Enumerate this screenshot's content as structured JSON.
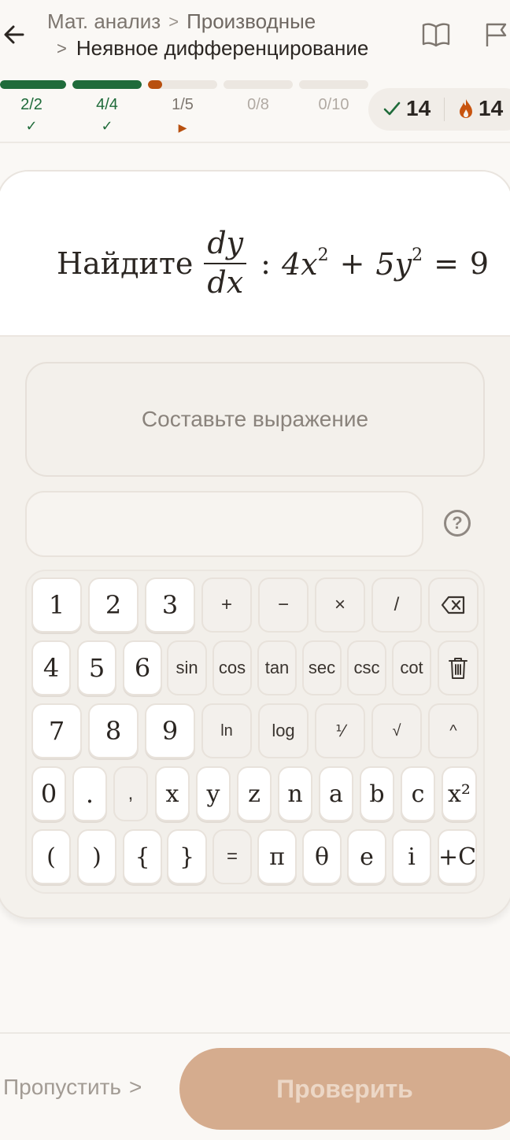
{
  "header": {
    "breadcrumb_root": "Мат. анализ",
    "breadcrumb_section": "Производные",
    "breadcrumb_current": "Неявное дифференцирование",
    "separator": ">"
  },
  "progress": {
    "segments": [
      {
        "label": "2/2",
        "fraction": 1.0,
        "state": "done",
        "mark": "✓",
        "color": "#1f6b3a"
      },
      {
        "label": "4/4",
        "fraction": 1.0,
        "state": "done",
        "mark": "✓",
        "color": "#1f6b3a"
      },
      {
        "label": "1/5",
        "fraction": 0.2,
        "state": "active",
        "mark": "▶",
        "color": "#b8500f"
      },
      {
        "label": "0/8",
        "fraction": 0.0,
        "state": "todo",
        "mark": "",
        "color": "#ece7e1"
      },
      {
        "label": "0/10",
        "fraction": 0.0,
        "state": "todo",
        "mark": "",
        "color": "#ece7e1"
      }
    ],
    "correct_count": "14",
    "streak_count": "14"
  },
  "question": {
    "prompt": "Найдите",
    "frac_num": "dy",
    "frac_den": "dx",
    "equation": {
      "colon": ":",
      "t1": "4x",
      "e1": "2",
      "plus": "+",
      "t2": "5y",
      "e2": "2",
      "eq": "=",
      "rhs": "9"
    }
  },
  "answer": {
    "placeholder": "Составьте выражение"
  },
  "help_label": "?",
  "keyboard": {
    "row1": [
      "1",
      "2",
      "3",
      "+",
      "−",
      "×",
      "/"
    ],
    "row2": [
      "4",
      "5",
      "6",
      "sin",
      "cos",
      "tan",
      "sec",
      "csc",
      "cot"
    ],
    "row3": [
      "7",
      "8",
      "9",
      "ln",
      "log",
      "⅟",
      "√",
      "^"
    ],
    "row4": [
      "0",
      ".",
      ",",
      "x",
      "y",
      "z",
      "n",
      "a",
      "b",
      "c",
      "x²"
    ],
    "row5": [
      "(",
      ")",
      "{",
      "}",
      "=",
      "π",
      "θ",
      "e",
      "i",
      "+C"
    ]
  },
  "footer": {
    "skip_label": "Пропустить",
    "skip_arrow": ">",
    "check_label": "Проверить"
  },
  "icons": {
    "back": "arrow-left-icon",
    "book": "book-icon",
    "flag": "flag-icon",
    "check": "check-icon",
    "flame": "flame-icon",
    "backspace": "backspace-icon",
    "trash": "trash-icon"
  }
}
